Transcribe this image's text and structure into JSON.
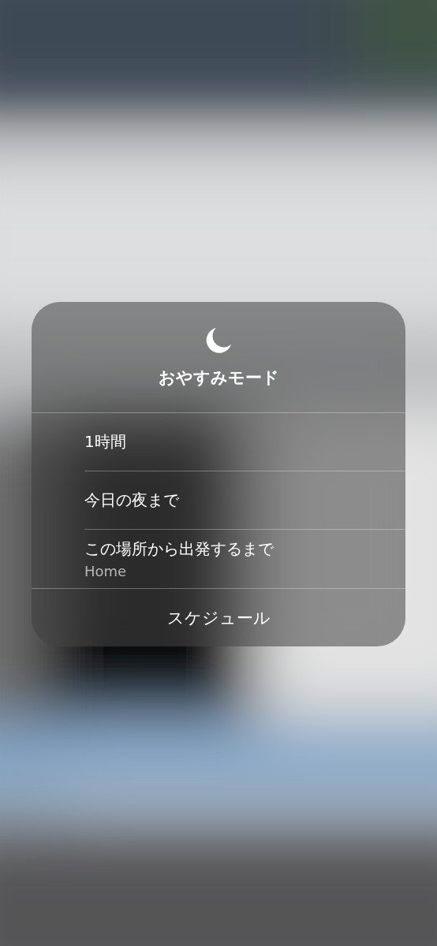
{
  "menu": {
    "title": "おやすみモード",
    "options": [
      {
        "label": "1時間"
      },
      {
        "label": "今日の夜まで"
      },
      {
        "label": "この場所から出発するまで",
        "detail": "Home"
      }
    ],
    "footer": "スケジュール"
  }
}
